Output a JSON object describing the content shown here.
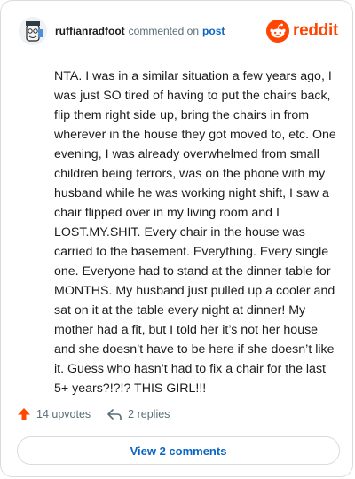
{
  "header": {
    "username": "ruffianradfoot",
    "action_text": "commented on",
    "post_link": "post",
    "brand_word": "reddit"
  },
  "comment": {
    "text": "NTA. I was in a similar situation a few years ago, I was just SO tired of having to put the chairs back, flip them right side up, bring the chairs in from wherever in the house they got moved to, etc. One evening, I was already overwhelmed from small children being terrors, was on the phone with my husband while he was working night shift, I saw a chair flipped over in my living room and I LOST.MY.SHIT. Every chair in the house was carried to the basement. Everything. Every single one. Everyone had to stand at the dinner table for MONTHS. My husband just pulled up a cooler and sat on it at the table every night at dinner! My mother had a fit, but I told her it’s not her house and she doesn’t have to be here if she doesn’t like it. Guess who hasn’t had to fix a chair for the last 5+ years?!?!? THIS GIRL!!!"
  },
  "actions": {
    "upvotes_label": "14 upvotes",
    "replies_label": "2 replies"
  },
  "footer": {
    "view_comments_label": "View 2 comments"
  },
  "icons": {
    "upvote": "upvote-arrow-icon",
    "reply": "reply-arrow-icon",
    "brand": "reddit-snoo-icon"
  },
  "colors": {
    "brand": "#ff4500",
    "link": "#0b66c3",
    "muted": "#576f76",
    "border": "#d9dcdf"
  }
}
